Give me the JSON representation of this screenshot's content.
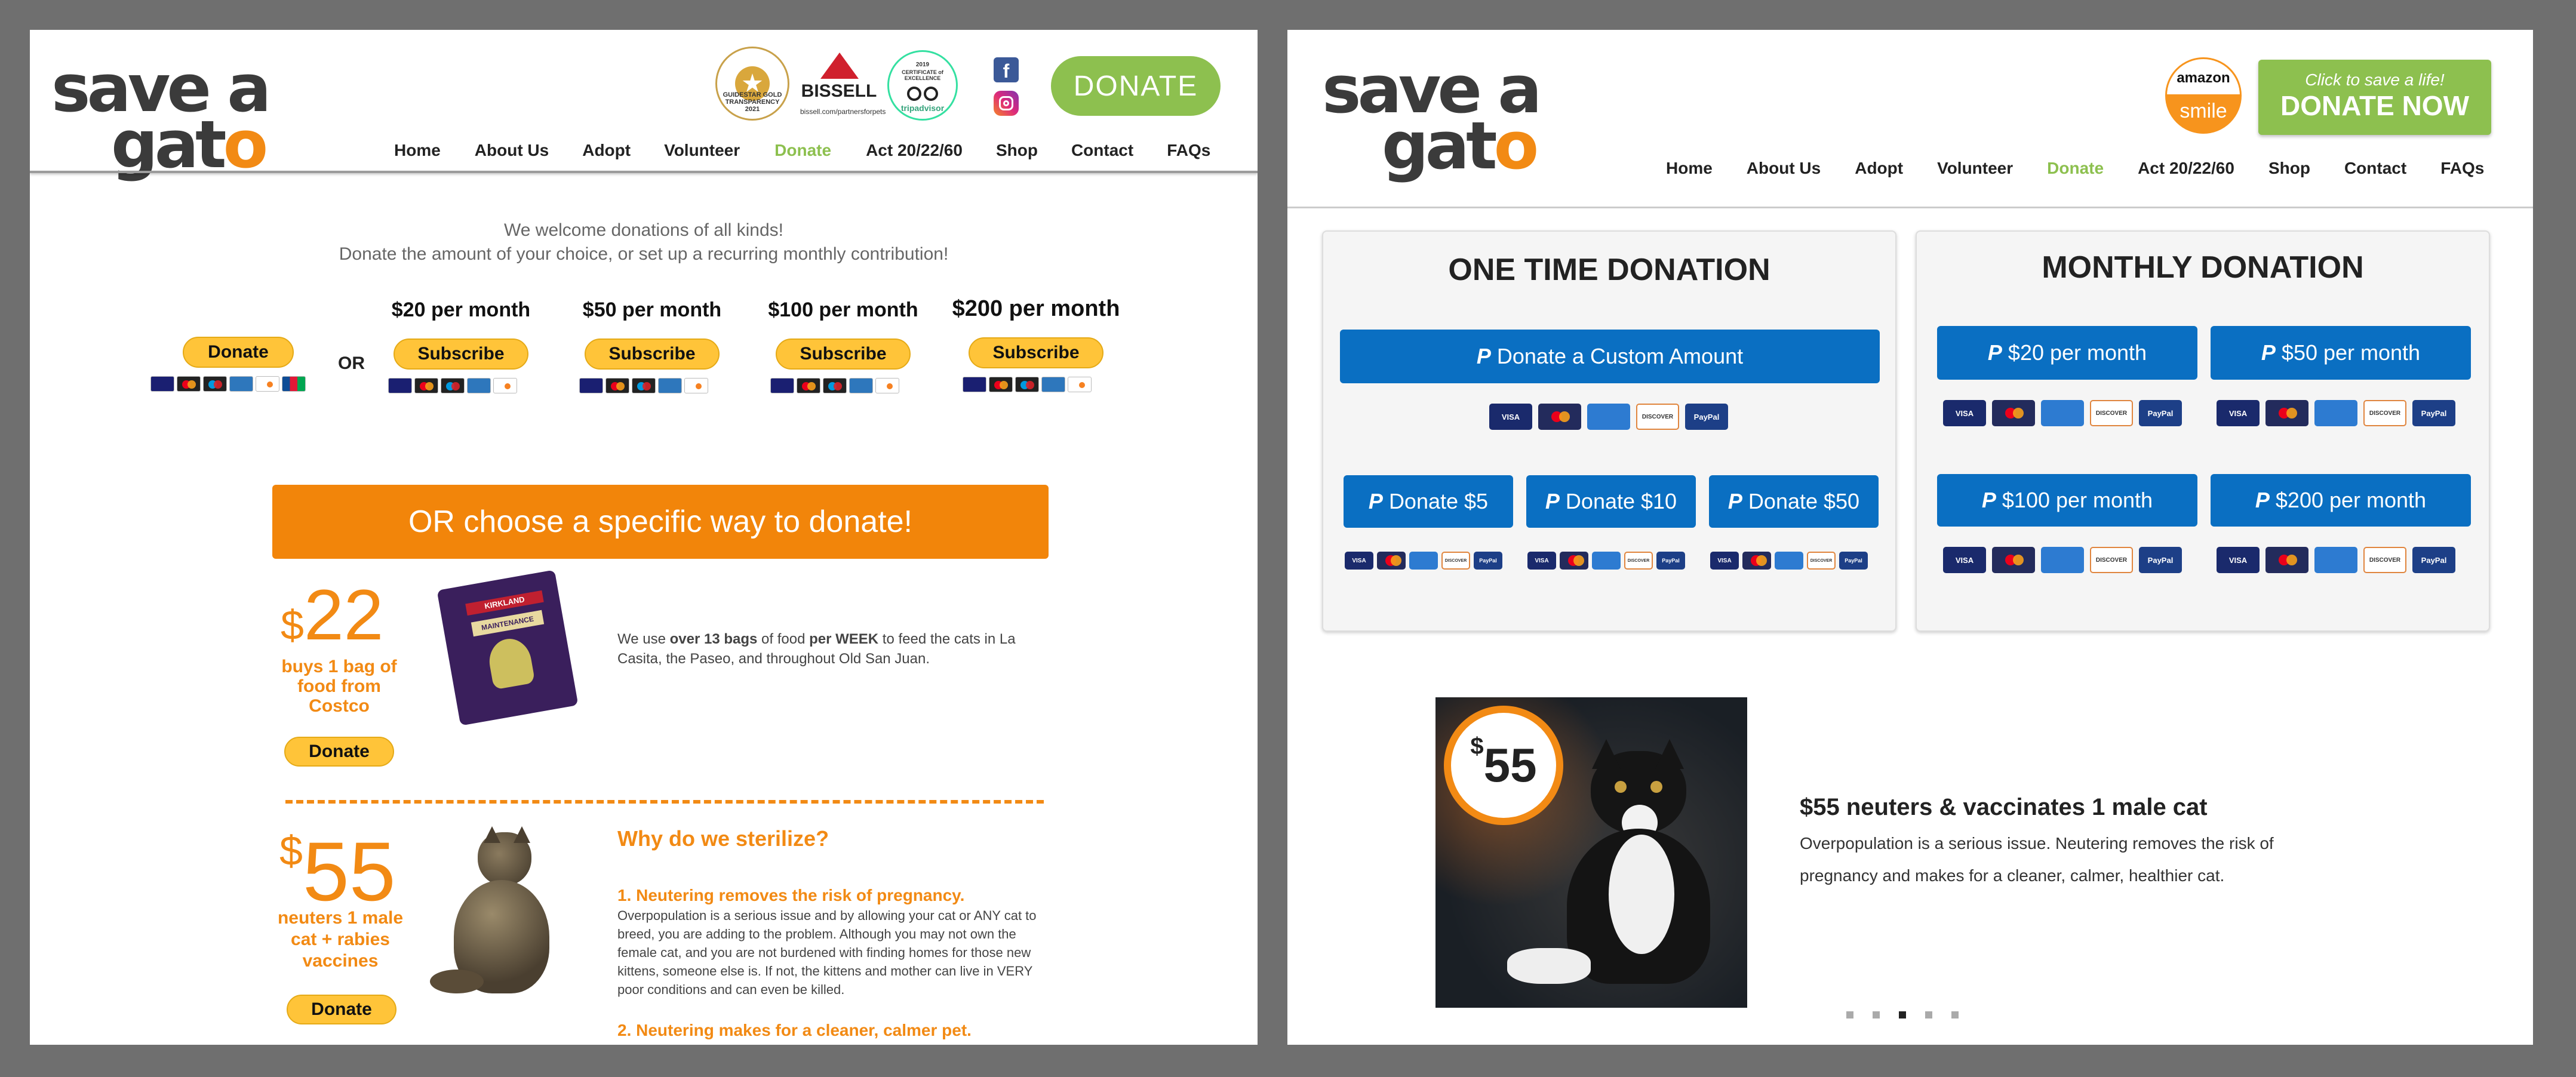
{
  "left": {
    "logo": {
      "line1": "save a",
      "line2": "gat",
      "o": "o"
    },
    "badges": {
      "guidestar": "GUIDESTAR GOLD TRANSPARENCY 2021",
      "bissell": "BISSELL",
      "bissell_url": "bissell.com/partnersforpets",
      "tripadvisor_year": "2019",
      "tripadvisor_cert": "CERTIFICATE of EXCELLENCE",
      "tripadvisor": "tripadvisor"
    },
    "donate_button": "DONATE",
    "nav": [
      "Home",
      "About Us",
      "Adopt",
      "Volunteer",
      "Donate",
      "Act 20/22/60",
      "Shop",
      "Contact",
      "FAQs"
    ],
    "welcome_line1": "We welcome donations of all kinds!",
    "welcome_line2": "Donate the amount of your choice, or set up a recurring monthly contribution!",
    "donate_btn": "Donate",
    "or": "OR",
    "subscriptions": [
      {
        "title": "$20 per month",
        "button": "Subscribe"
      },
      {
        "title": "$50 per month",
        "button": "Subscribe"
      },
      {
        "title": "$100 per month",
        "button": "Subscribe"
      },
      {
        "title": "$200 per month",
        "button": "Subscribe"
      }
    ],
    "banner": "OR choose a specific way to donate!",
    "food": {
      "currency": "$",
      "amount": "22",
      "caption": "buys 1 bag of food from Costco",
      "button": "Donate",
      "bag_brand": "KIRKLAND",
      "bag_label": "MAINTENANCE",
      "text_pre": "We use ",
      "text_b1": "over 13 bags",
      "text_mid": " of food ",
      "text_b2": "per WEEK",
      "text_post": " to feed the cats in La Casita, the Paseo, and throughout Old San Juan."
    },
    "neuter": {
      "currency": "$",
      "amount": "55",
      "caption": "neuters 1 male cat + rabies vaccines",
      "button": "Donate",
      "heading": "Why do we sterilize?",
      "point1_title": "1. Neutering removes the risk of pregnancy.",
      "point1_text": "Overpopulation is a serious issue and by allowing your cat or ANY cat to breed, you are adding to the problem. Although you may not own the female cat, and you are not burdened with finding homes for those new kittens, someone else is. If not, the kittens and mother can live in VERY poor conditions and can even be killed.",
      "point2_title": "2. Neutering makes for a cleaner, calmer pet."
    }
  },
  "right": {
    "logo": {
      "line1": "save a",
      "line2": "gat",
      "o": "o"
    },
    "amazon_top": "amazon",
    "amazon_bottom": "smile",
    "cta_small": "Click to save a life!",
    "cta_big": "DONATE NOW",
    "nav": [
      "Home",
      "About Us",
      "Adopt",
      "Volunteer",
      "Donate",
      "Act 20/22/60",
      "Shop",
      "Contact",
      "FAQs"
    ],
    "one_time": {
      "title": "ONE TIME DONATION",
      "custom": "Donate a Custom Amount",
      "buttons": [
        "Donate $5",
        "Donate $10",
        "Donate $50"
      ]
    },
    "monthly": {
      "title": "MONTHLY DONATION",
      "buttons": [
        "$20 per month",
        "$50 per month",
        "$100 per month",
        "$200 per month"
      ]
    },
    "card_labels": {
      "visa": "VISA",
      "amex": "AMEX",
      "discover": "DISCOVER",
      "paypal": "PayPal"
    },
    "slide": {
      "badge_currency": "$",
      "badge_amount": "55",
      "title": "$55 neuters & vaccinates 1 male cat",
      "text": "Overpopulation is a serious issue. Neutering removes the risk of pregnancy and makes for a cleaner, calmer, healthier cat."
    },
    "carousel": {
      "count": 5,
      "active": 3
    }
  },
  "colors": {
    "accent_orange": "#f28a14",
    "accent_green": "#8dc04f",
    "paypal_blue": "#0a6fc2",
    "paypal_gold": "#ffc439"
  },
  "icons": [
    "facebook-icon",
    "instagram-icon",
    "paypal-icon"
  ]
}
